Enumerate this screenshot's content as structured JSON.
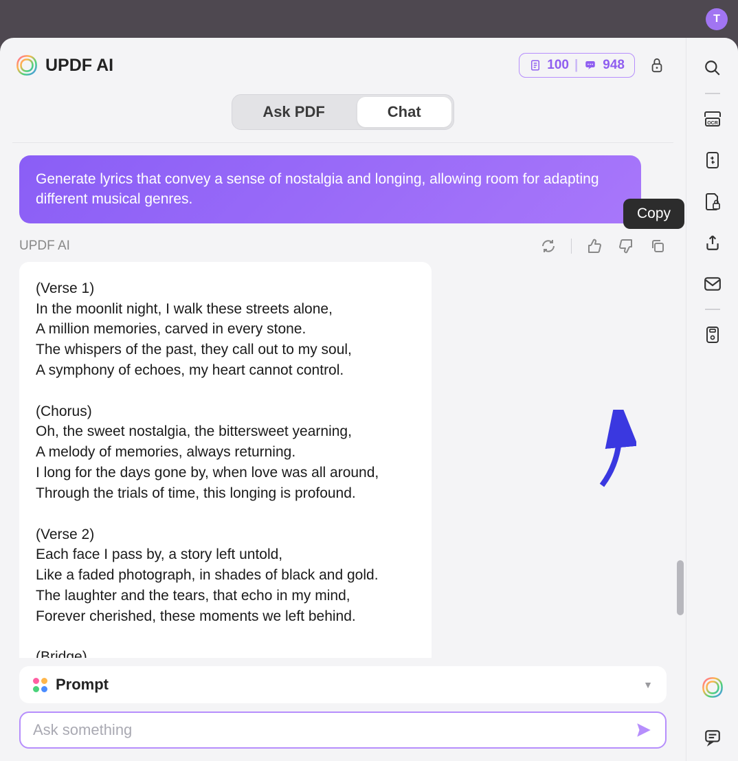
{
  "avatar": {
    "initial": "T"
  },
  "header": {
    "title": "UPDF AI",
    "pages_count": "100",
    "tokens_count": "948"
  },
  "tabs": {
    "ask_pdf": "Ask PDF",
    "chat": "Chat"
  },
  "conversation": {
    "user_message": "Generate lyrics that convey a sense of nostalgia and longing, allowing room for adapting different musical genres.",
    "ai_label": "UPDF AI",
    "ai_response": "(Verse 1)\nIn the moonlit night, I walk these streets alone,\nA million memories, carved in every stone.\nThe whispers of the past, they call out to my soul,\nA symphony of echoes, my heart cannot control.\n\n(Chorus)\nOh, the sweet nostalgia, the bittersweet yearning,\nA melody of memories, always returning.\nI long for the days gone by, when love was all around,\nThrough the trials of time, this longing is profound.\n\n(Verse 2)\nEach face I pass by, a story left untold,\nLike a faded photograph, in shades of black and gold.\nThe laughter and the tears, that echo in my mind,\nForever cherished, these moments we left behind.\n\n(Bridge)"
  },
  "tooltip": {
    "copy": "Copy"
  },
  "prompt_bar": {
    "label": "Prompt"
  },
  "input": {
    "placeholder": "Ask something"
  }
}
